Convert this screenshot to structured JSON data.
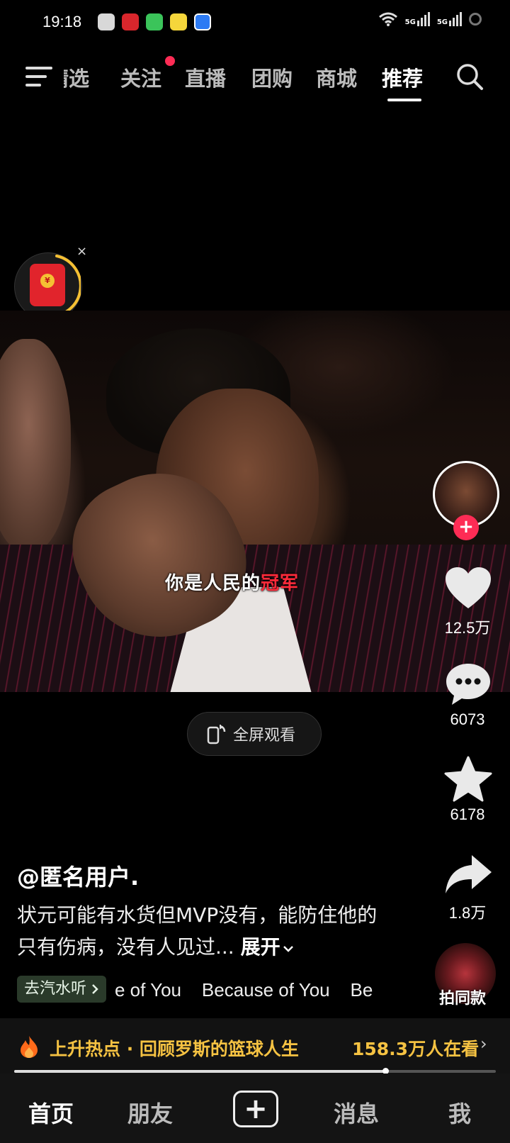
{
  "status_bar": {
    "time": "19:18",
    "network_1": "5G",
    "network_2": "5G"
  },
  "top_nav": {
    "tabs": [
      {
        "label": "精选"
      },
      {
        "label": "关注"
      },
      {
        "label": "直播"
      },
      {
        "label": "团购"
      },
      {
        "label": "商城"
      },
      {
        "label": "推荐"
      }
    ],
    "active_tab": "推荐",
    "icons": {
      "menu": "menu-icon",
      "search": "search-icon"
    }
  },
  "red_packet": {
    "coin": "¥",
    "close": "×"
  },
  "video": {
    "subtitle_main": "你是人民的",
    "subtitle_highlight": "冠军"
  },
  "fullscreen": {
    "label": "全屏观看"
  },
  "actions": {
    "like_count": "12.5万",
    "comment_count": "6073",
    "favorite_count": "6178",
    "share_count": "1.8万",
    "same_style_label": "拍同款",
    "follow_symbol": "+"
  },
  "caption": {
    "author": "@匿名用户.",
    "description": "状元可能有水货但MVP没有，能防住他的只有伤病，没有人见过...",
    "expand_label": "展开"
  },
  "music": {
    "tag_label": "去汽水听",
    "ticker": "e of You    Because of You    Be"
  },
  "hot": {
    "text": "上升热点 · 回顾罗斯的篮球人生",
    "viewers": "158.3万人在看",
    "arrow": "›"
  },
  "playback": {
    "progress_fraction": 0.77
  },
  "bottom_nav": {
    "items": [
      "首页",
      "朋友",
      "消息",
      "我"
    ],
    "plus": "+"
  },
  "colors": {
    "accent_red": "#fe2c55",
    "hot_gold": "#f5c242",
    "background": "#000000"
  }
}
